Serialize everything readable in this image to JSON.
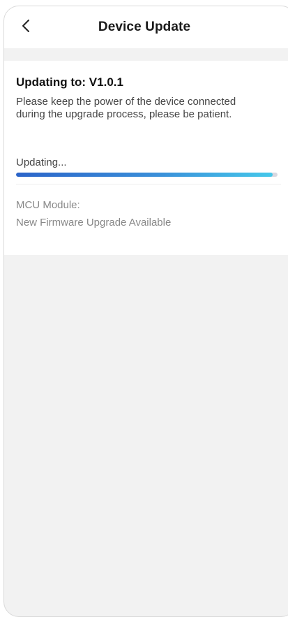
{
  "header": {
    "title": "Device Update",
    "back_icon": "chevron-left-icon"
  },
  "update": {
    "target_version_text": "Updating to: V1.0.1",
    "notice": "Please keep the power of the device connected during the upgrade process, please be patient.",
    "status_label": "Updating...",
    "progress_fraction": 0.98,
    "progress_colors": [
      "#2b64c9",
      "#45c8ea"
    ]
  },
  "module": {
    "name_label": "MCU Module:",
    "status_text": "New Firmware Upgrade Available"
  }
}
